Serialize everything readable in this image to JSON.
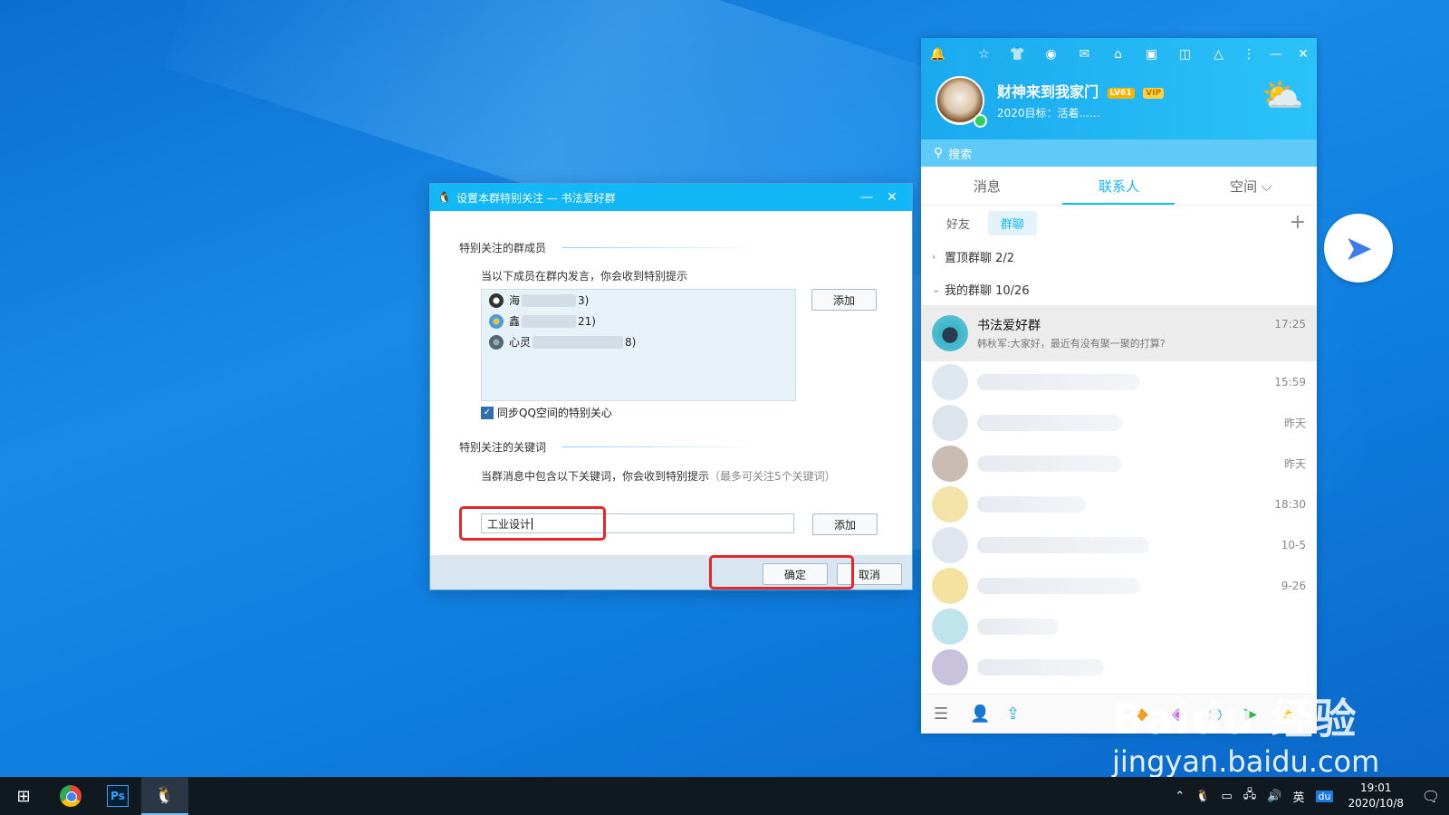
{
  "dialog": {
    "title": "设置本群特别关注 — 书法爱好群",
    "minimize": "—",
    "close": "✕",
    "members_section": "特别关注的群成员",
    "members_hint": "当以下成员在群内发言，你会收到特别提示",
    "members": [
      {
        "prefix": "海",
        "suffix": "3)"
      },
      {
        "prefix": "鑫",
        "suffix": "21)"
      },
      {
        "prefix": "心灵",
        "suffix": "8)"
      }
    ],
    "add_member_button": "添加",
    "sync_checkbox_label": "同步QQ空间的特别关心",
    "sync_checked": true,
    "keywords_section": "特别关注的关键词",
    "keywords_hint": "当群消息中包含以下关键词，你会收到特别提示",
    "keywords_hint_note": "（最多可关注5个关键词）",
    "keyword_input_value": "工业设计",
    "add_keyword_button": "添加",
    "ok_button": "确定",
    "cancel_button": "取消"
  },
  "qq": {
    "nickname": "财神来到我家门",
    "level_badge": "LV61",
    "vip_badge": "VIP",
    "signature": "2020目标：活着......",
    "search_placeholder": "搜索",
    "tabs": [
      {
        "label": "消息"
      },
      {
        "label": "联系人"
      },
      {
        "label": "空间 ⌵"
      }
    ],
    "active_tab": "联系人",
    "sub_tabs": [
      "好友",
      "群聊"
    ],
    "active_sub_tab": "群聊",
    "groups": [
      {
        "label": "置顶群聊 2/2",
        "chev": "›"
      },
      {
        "label": "我的群聊 10/26",
        "chev": "⌄"
      }
    ],
    "selected_chat": {
      "name": "书法爱好群",
      "message": "韩秋军:大家好，最近有没有聚一聚的打算?",
      "time": "17:25"
    },
    "chat_times": [
      "15:59",
      "昨天",
      "昨天",
      "18:30",
      "10-5",
      "9-26"
    ],
    "colors": {
      "accent": "#12b7f5",
      "highlight_box": "#e62727"
    }
  },
  "watermark": {
    "line1": "Baidu 经验",
    "line2": "jingyan.baidu.com"
  },
  "taskbar": {
    "ime": "英",
    "time": "19:01",
    "date": "2020/10/8",
    "ps_label": "Ps"
  }
}
